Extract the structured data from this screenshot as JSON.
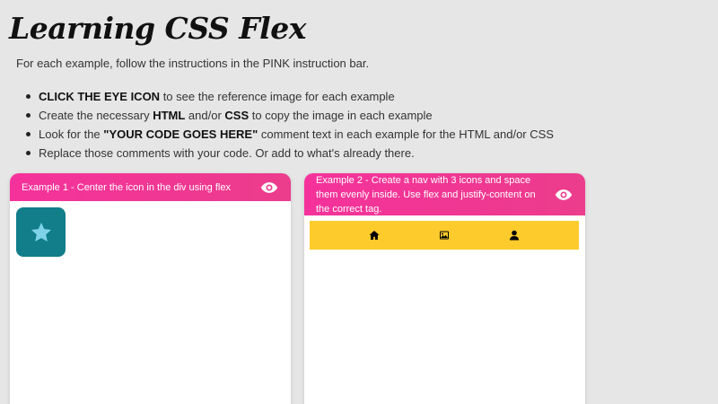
{
  "header": {
    "title": "Learning CSS Flex",
    "intro": "For each example, follow the instructions in the PINK instruction bar."
  },
  "instructions": [
    {
      "bold": "CLICK THE EYE ICON",
      "rest": " to see the reference image for each example"
    },
    {
      "pre": "Create the necessary ",
      "b1": "HTML",
      "mid": " and/or ",
      "b2": "CSS",
      "rest": " to copy the image in each example"
    },
    {
      "pre": "Look for the ",
      "bold": "\"YOUR CODE GOES HERE\"",
      "rest": " comment text in each example for the HTML and/or CSS"
    },
    {
      "text": "Replace those comments with your code. Or add to what's already there."
    }
  ],
  "examples": [
    {
      "instruction": "Example 1 - Center the icon in the div using flex",
      "icon": "star-icon",
      "icon_bg": "#117e8a"
    },
    {
      "instruction": "Example 2 - Create a nav with 3 icons and space them evenly inside. Use flex and justify-content on the correct tag.",
      "nav_icons": [
        "home-icon",
        "image-icon",
        "user-icon"
      ],
      "nav_bg": "#fdcb2b"
    }
  ],
  "colors": {
    "accent_pink": "#f5329b",
    "background": "#e6e6e6"
  }
}
